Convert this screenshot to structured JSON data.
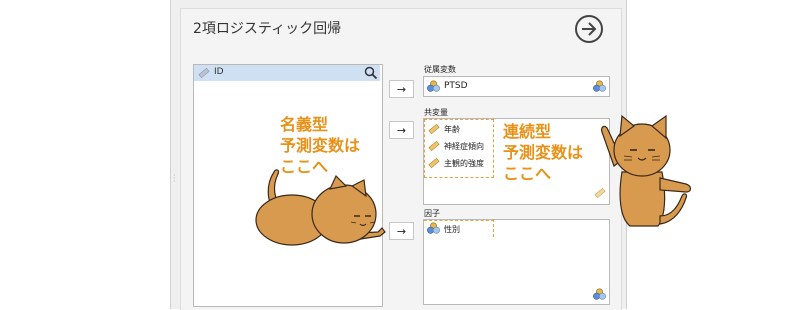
{
  "window": {
    "title": "2項ロジスティック回帰"
  },
  "variable_list": {
    "items": [
      "ID"
    ]
  },
  "dependent": {
    "label": "従属変数",
    "value": "PTSD"
  },
  "covariates": {
    "label": "共変量",
    "items": [
      "年齢",
      "神経症傾向",
      "主観的強度"
    ]
  },
  "factors": {
    "label": "因子",
    "items": [
      "性別"
    ]
  },
  "arrow_glyph": "→",
  "annotations": {
    "nominal": [
      "名義型",
      "予測変数は",
      "ここへ"
    ],
    "continuous": [
      "連続型",
      "予測変数は",
      "ここへ"
    ]
  },
  "colors": {
    "accent_orange": "#e8921a",
    "highlight_blue": "#cfe0f3",
    "cat_fill": "#d89a4e",
    "cat_stroke": "#3a2a1a"
  },
  "icons": [
    "forward-circle-icon",
    "ruler-icon",
    "search-icon",
    "nominal-icon",
    "scale-icon"
  ]
}
